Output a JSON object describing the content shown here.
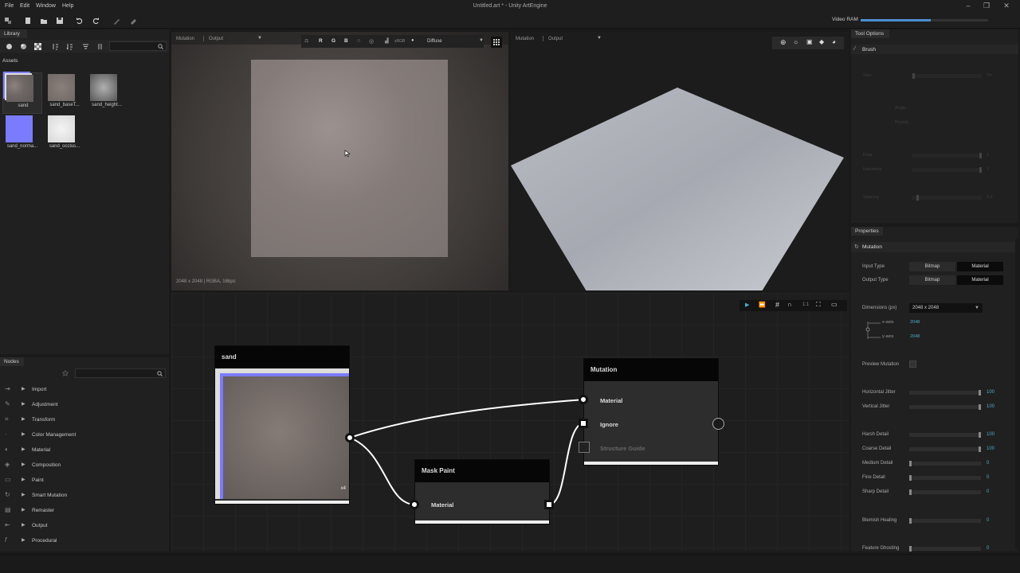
{
  "menu": [
    "File",
    "Edit",
    "Window",
    "Help"
  ],
  "window_title": "Untitled.art * - Unity ArtEngine",
  "toolbar": {
    "vram_label": "Video RAM",
    "vram_fraction": 0.55
  },
  "library": {
    "title": "Library",
    "assets_label": "Assets",
    "assets": [
      {
        "name": "sand"
      },
      {
        "name": "sand_baseT..."
      },
      {
        "name": "sand_height..."
      },
      {
        "name": "sand_norma..."
      },
      {
        "name": "sand_occlus..."
      }
    ]
  },
  "nodes_panel": {
    "title": "Nodes",
    "categories": [
      "Import",
      "Adjustment",
      "Transform",
      "Color Management",
      "Material",
      "Composition",
      "Paint",
      "Smart Mutation",
      "Remaster",
      "Output",
      "Procedural"
    ]
  },
  "viewport2d": {
    "mode": "Mutation",
    "output": "Output",
    "channels": [
      "R",
      "G",
      "B"
    ],
    "channel_mode": "sRGB",
    "map": "Diffuse",
    "info": "2048 x 2048 | RGBA, 16bpc"
  },
  "viewport3d": {
    "mode": "Mutation",
    "output": "Output"
  },
  "graph": {
    "sand_node": {
      "title": "sand",
      "badge": "x4"
    },
    "mask_node": {
      "title": "Mask Paint",
      "input": "Material"
    },
    "mutation_node": {
      "title": "Mutation",
      "inputs": [
        "Material",
        "Ignore",
        "Structure Guide"
      ]
    },
    "zoom_label": "1:1"
  },
  "tool_options": {
    "title": "Tool Options",
    "tool": "Brush",
    "rows": [
      {
        "label": "Size",
        "value": "74"
      },
      {
        "label": "Angle",
        "value": ""
      },
      {
        "label": "Round...",
        "value": ""
      },
      {
        "label": "Flow",
        "value": "1"
      },
      {
        "label": "Hardness",
        "value": "1"
      },
      {
        "label": "Spacing",
        "value": "0.2"
      }
    ]
  },
  "properties": {
    "title": "Properties",
    "node": "Mutation",
    "input_type_label": "Input Type",
    "output_type_label": "Output Type",
    "type_options": [
      "Bitmap",
      "Material"
    ],
    "dimensions_label": "Dimensions (px)",
    "dimensions_value": "2048 x 2048",
    "x_axis_label": "x-axis",
    "x_axis_value": "2048",
    "y_axis_label": "y-axis",
    "y_axis_value": "2048",
    "preview_label": "Preview Mutation",
    "sliders": [
      {
        "label": "Horizontal Jitter",
        "value": "100",
        "fraction": 1.0
      },
      {
        "label": "Vertical Jitter",
        "value": "100",
        "fraction": 1.0
      },
      {
        "label": "Harsh Detail",
        "value": "100",
        "fraction": 1.0
      },
      {
        "label": "Coarse Detail",
        "value": "100",
        "fraction": 1.0
      },
      {
        "label": "Medium Detail",
        "value": "0",
        "fraction": 0.0
      },
      {
        "label": "Fine Detail",
        "value": "0",
        "fraction": 0.0
      },
      {
        "label": "Sharp Detail",
        "value": "0",
        "fraction": 0.0
      },
      {
        "label": "Blemish Healing",
        "value": "0",
        "fraction": 0.0
      },
      {
        "label": "Feature Ghosting",
        "value": "0",
        "fraction": 0.0
      }
    ]
  }
}
